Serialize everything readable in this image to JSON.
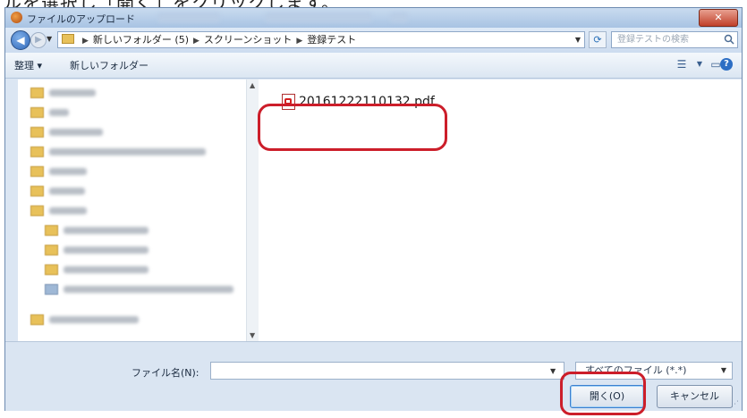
{
  "caption": {
    "partial_text": "ルを選択し「開く」をクリックします。"
  },
  "window": {
    "title": "ファイルのアップロード",
    "close": "✕"
  },
  "address": {
    "path": [
      "新しいフォルダー (5)",
      "スクリーンショット",
      "登録テスト"
    ],
    "search_placeholder": "登録テストの検索"
  },
  "toolbar": {
    "organize": "整理 ▾",
    "new_folder": "新しいフォルダー",
    "view_icon": "view-options-icon",
    "preview_icon": "preview-pane-icon",
    "help": "?"
  },
  "files": [
    {
      "name": "20161222110132.pdf",
      "icon": "pdf-icon"
    }
  ],
  "bottom": {
    "filename_label": "ファイル名(N):",
    "filename_value": "",
    "filter": "すべてのファイル (*.*)",
    "open": "開く(O)",
    "cancel": "キャンセル"
  },
  "colors": {
    "highlight": "#cc1e2a",
    "accent": "#2d6ec4"
  }
}
